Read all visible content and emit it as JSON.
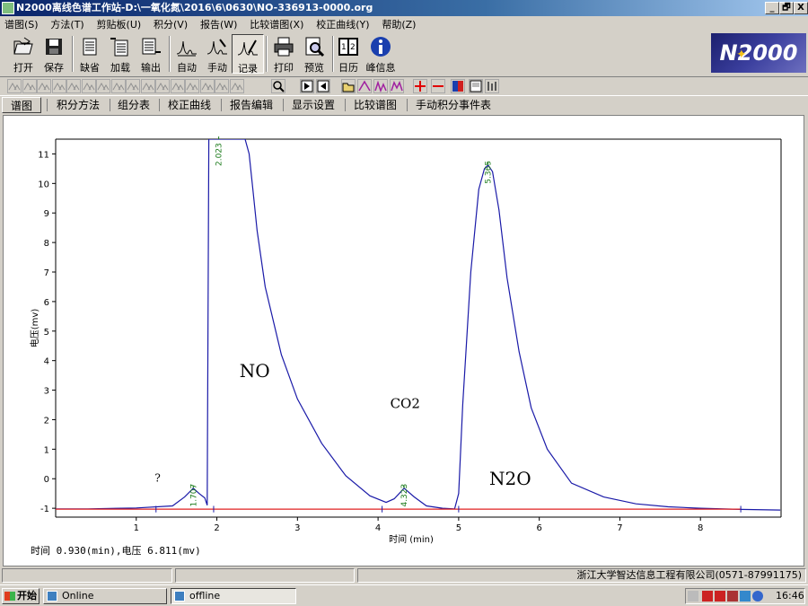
{
  "window": {
    "title": "N2000离线色谱工作站-D:\\一氧化氮\\2016\\6\\0630\\NO-336913-0000.org",
    "buttons": [
      "_",
      "🗗",
      "X"
    ]
  },
  "menu": [
    "谱图(S)",
    "方法(T)",
    "剪贴板(U)",
    "积分(V)",
    "报告(W)",
    "比较谱图(X)",
    "校正曲线(Y)",
    "帮助(Z)"
  ],
  "toolbar": {
    "open": "打开",
    "save": "保存",
    "default": "缺省",
    "load": "加载",
    "export": "输出",
    "auto": "自动",
    "manual": "手动",
    "record": "记录",
    "print": "打印",
    "preview": "预览",
    "calendar": "日历",
    "peak_info": "峰信息"
  },
  "logo_text": "N2000",
  "tabs": [
    "谱图",
    "积分方法",
    "组分表",
    "校正曲线",
    "报告编辑",
    "显示设置",
    "比较谱图",
    "手动积分事件表"
  ],
  "chart_data": {
    "type": "line",
    "xlabel": "时间 (min)",
    "ylabel": "电压(mv)",
    "xlim": [
      0,
      9
    ],
    "ylim": [
      -1.3,
      11.5
    ],
    "xticks": [
      1,
      2,
      3,
      4,
      5,
      6,
      7,
      8
    ],
    "yticks": [
      -1,
      0,
      1,
      2,
      3,
      4,
      5,
      6,
      7,
      8,
      9,
      10,
      11
    ],
    "series": [
      {
        "color": "#1a1aa8",
        "x": [
          0.0,
          0.4,
          1.0,
          1.45,
          1.6,
          1.707,
          1.78,
          1.85,
          1.88,
          1.9,
          1.96,
          2.023,
          2.07,
          2.35,
          2.4,
          2.45,
          2.5,
          2.6,
          2.8,
          3.0,
          3.3,
          3.6,
          3.9,
          4.1,
          4.2,
          4.323,
          4.45,
          4.6,
          4.8,
          4.95,
          5.0,
          5.05,
          5.15,
          5.25,
          5.32,
          5.365,
          5.42,
          5.5,
          5.6,
          5.75,
          5.9,
          6.1,
          6.4,
          6.8,
          7.2,
          7.6,
          8.0,
          8.5,
          8.99
        ],
        "y": [
          -1.02,
          -1.02,
          -0.99,
          -0.92,
          -0.62,
          -0.32,
          -0.5,
          -0.65,
          -0.9,
          11.5,
          11.5,
          11.5,
          11.5,
          11.5,
          11.0,
          9.7,
          8.4,
          6.5,
          4.2,
          2.7,
          1.2,
          0.1,
          -0.58,
          -0.8,
          -0.68,
          -0.32,
          -0.62,
          -0.92,
          -1.0,
          -1.02,
          -0.5,
          2.5,
          7.0,
          9.8,
          10.5,
          10.62,
          10.4,
          9.1,
          6.8,
          4.3,
          2.4,
          1.0,
          -0.15,
          -0.62,
          -0.85,
          -0.95,
          -1.0,
          -1.04,
          -1.06
        ]
      },
      {
        "color": "#e02020",
        "x": [
          0.0,
          8.5
        ],
        "y": [
          -1.03,
          -1.03
        ]
      }
    ],
    "peak_labels": [
      {
        "x": 1.707,
        "text": "1.707"
      },
      {
        "x": 2.023,
        "text": "2.023"
      },
      {
        "x": 4.323,
        "text": "4.323"
      },
      {
        "x": 5.365,
        "text": "5.365"
      }
    ],
    "annotations": [
      {
        "x": 1.23,
        "y": -0.1,
        "text": "?"
      },
      {
        "x": 2.28,
        "y": 3.45,
        "text": "NO"
      },
      {
        "x": 4.15,
        "y": 2.4,
        "text": "CO2"
      },
      {
        "x": 5.38,
        "y": -0.2,
        "text": "N2O"
      }
    ]
  },
  "status": {
    "readout": "时间 0.930(min),电压 6.811(mv)",
    "company": "浙江大学智达信息工程有限公司(0571-87991175)"
  },
  "taskbar": {
    "start": "开始",
    "tasks": [
      "Online",
      "offline"
    ],
    "clock": "16:46"
  }
}
